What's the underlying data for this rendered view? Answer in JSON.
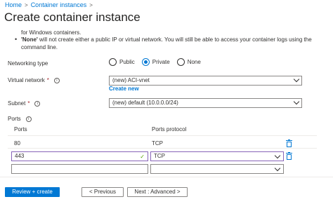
{
  "breadcrumb": {
    "home": "Home",
    "sep1": ">",
    "section": "Container instances",
    "sep2": ">"
  },
  "page": {
    "title": "Create container instance"
  },
  "intro": {
    "partial_line": "for Windows containers.",
    "bullet": "•",
    "none_bold": "'None'",
    "none_text": " will not create either a public IP or virtual network. You will still be able to access your container logs using the command line."
  },
  "networking": {
    "label": "Networking type",
    "options": [
      {
        "label": "Public",
        "checked": false
      },
      {
        "label": "Private",
        "checked": true
      },
      {
        "label": "None",
        "checked": false
      }
    ]
  },
  "virtual_network": {
    "label": "Virtual network",
    "required": "*",
    "info": "i",
    "value": "(new) ACI-vnet",
    "create_new": "Create new"
  },
  "subnet": {
    "label": "Subnet",
    "required": "*",
    "info": "i",
    "value": "(new) default (10.0.0.0/24)"
  },
  "ports": {
    "label": "Ports",
    "info": "i",
    "col_ports": "Ports",
    "col_protocol": "Ports protocol",
    "rows": [
      {
        "port": "80",
        "protocol": "TCP"
      },
      {
        "port": "443",
        "protocol": "TCP"
      },
      {
        "port": "",
        "protocol": ""
      }
    ],
    "check": "✓"
  },
  "footer": {
    "review": "Review + create",
    "previous": "< Previous",
    "next": "Next : Advanced >"
  },
  "colors": {
    "accent": "#0078d4",
    "focus": "#8764b8",
    "valid": "#57a300"
  }
}
